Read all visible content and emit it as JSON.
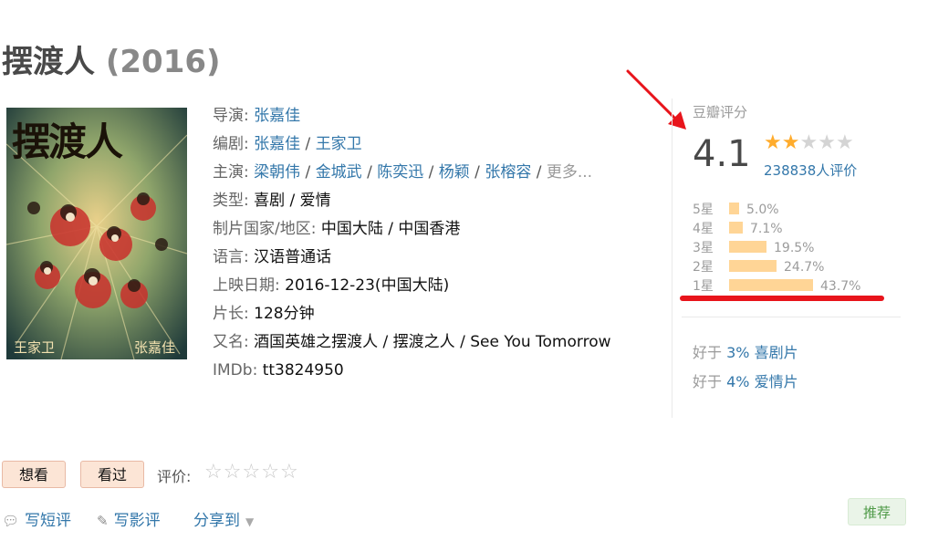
{
  "movie": {
    "title": "摆渡人",
    "year": "(2016)"
  },
  "poster": {
    "title_glyphs": "摆渡人",
    "left_credit": "王家卫",
    "right_credit": "张嘉佳"
  },
  "info": {
    "director_label": "导演: ",
    "director": "张嘉佳",
    "writer_label": "编剧: ",
    "writers": [
      "张嘉佳",
      "王家卫"
    ],
    "cast_label": "主演: ",
    "cast": [
      "梁朝伟",
      "金城武",
      "陈奕迅",
      "杨颖",
      "张榕容"
    ],
    "cast_more": "更多...",
    "genre_label": "类型: ",
    "genres": "喜剧 / 爱情",
    "country_label": "制片国家/地区: ",
    "country": "中国大陆 / 中国香港",
    "language_label": "语言: ",
    "language": "汉语普通话",
    "release_label": "上映日期: ",
    "release": "2016-12-23(中国大陆)",
    "runtime_label": "片长: ",
    "runtime": "128分钟",
    "aka_label": "又名: ",
    "aka": "酒国英雄之摆渡人 / 摆渡之人 / See You Tomorrow",
    "imdb_label": "IMDb: ",
    "imdb": "tt3824950"
  },
  "rating": {
    "label": "豆瓣评分",
    "score": "4.1",
    "stars": 2,
    "votes": "238838人评价",
    "distribution": [
      {
        "label": "5星",
        "percent": 5.0,
        "text": "5.0%"
      },
      {
        "label": "4星",
        "percent": 7.1,
        "text": "7.1%"
      },
      {
        "label": "3星",
        "percent": 19.5,
        "text": "19.5%"
      },
      {
        "label": "2星",
        "percent": 24.7,
        "text": "24.7%"
      },
      {
        "label": "1星",
        "percent": 43.7,
        "text": "43.7%"
      }
    ],
    "better_than": [
      {
        "prefix": "好于 ",
        "link": "3% 喜剧片"
      },
      {
        "prefix": "好于 ",
        "link": "4% 爱情片"
      }
    ]
  },
  "actions": {
    "want": "想看",
    "watched": "看过",
    "rate_label": "评价:",
    "short_review": "写短评",
    "review": "写影评",
    "share": "分享到",
    "recommend": "推荐"
  },
  "colors": {
    "link": "#3377aa",
    "star": "#ffac2d",
    "bar": "#ffd596",
    "highlight": "#e8141b",
    "recommend": "#4f9a48"
  }
}
